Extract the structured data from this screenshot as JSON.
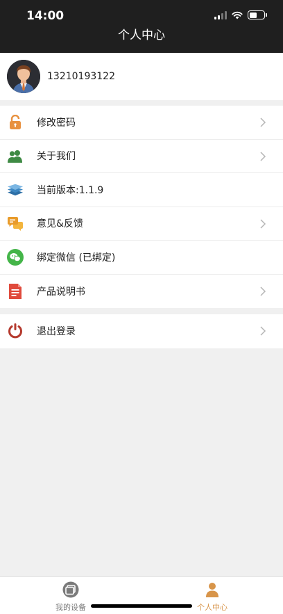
{
  "status_bar": {
    "time": "14:00"
  },
  "header": {
    "title": "个人中心"
  },
  "profile": {
    "phone": "13210193122"
  },
  "menu": {
    "change_password": "修改密码",
    "about_us": "关于我们",
    "version": "当前版本:1.1.9",
    "feedback": "意见&反馈",
    "bind_wechat": "绑定微信 (已绑定)",
    "manual": "产品说明书",
    "logout": "退出登录"
  },
  "icons": {
    "change_password": "lock-icon",
    "about_us": "users-icon",
    "version": "layers-icon",
    "feedback": "chat-bubble-icon",
    "bind_wechat": "wechat-icon",
    "manual": "document-icon",
    "logout": "power-icon"
  },
  "tabbar": {
    "devices": "我的设备",
    "profile": "个人中心"
  },
  "colors": {
    "header_bg": "#1f1f1f",
    "active_tab": "#d8954a",
    "inactive_tab": "#7a7a7a",
    "page_bg": "#f0f0f0"
  }
}
